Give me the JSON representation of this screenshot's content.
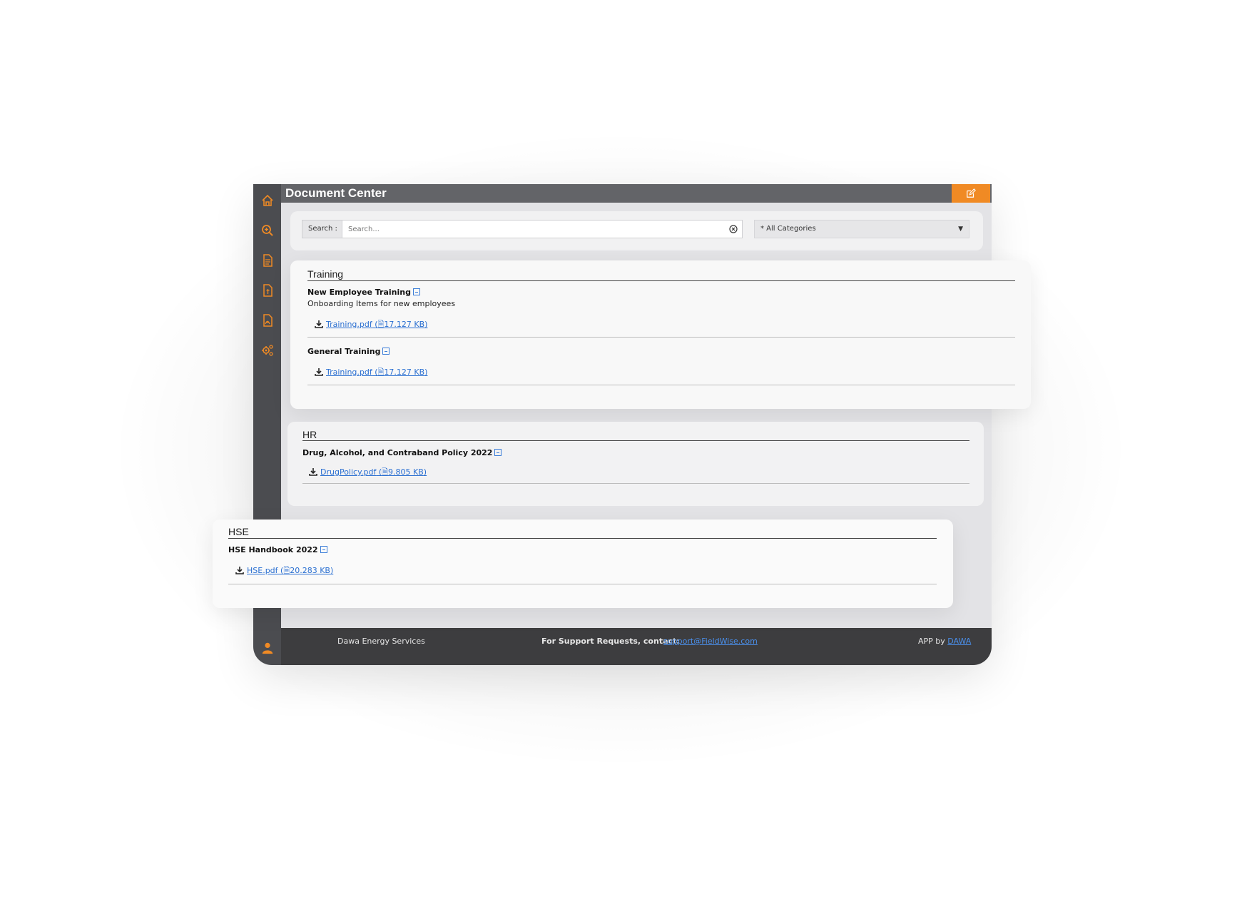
{
  "header": {
    "title": "Document Center"
  },
  "sidebar": {
    "icons": [
      "home-icon",
      "search-zoom-icon",
      "document-icon",
      "report-icon",
      "pdf-icon",
      "settings-icon"
    ],
    "user_icon": "user-icon"
  },
  "search": {
    "label": "Search :",
    "placeholder": "Search...",
    "category": "* All Categories"
  },
  "categories": [
    {
      "name": "Training",
      "items": [
        {
          "title": "New Employee Training",
          "description": "Onboarding Items for new employees",
          "file": {
            "name": "Training.pdf",
            "size": "17.127 KB"
          }
        },
        {
          "title": "General Training",
          "description": "",
          "file": {
            "name": "Training.pdf",
            "size": "17.127 KB"
          }
        }
      ]
    },
    {
      "name": "HR",
      "items": [
        {
          "title": "Drug, Alcohol, and Contraband Policy 2022",
          "description": "",
          "file": {
            "name": "DrugPolicy.pdf",
            "size": "9.805 KB"
          }
        }
      ]
    },
    {
      "name": "HSE",
      "items": [
        {
          "title": "HSE Handbook 2022",
          "description": "",
          "file": {
            "name": "HSE.pdf",
            "size": "20.283 KB"
          }
        }
      ]
    }
  ],
  "footer": {
    "company": "Dawa Energy Services",
    "support_label": "For Support Requests, contact:",
    "support_email": "support@FieldWise.com",
    "app_by": "APP by",
    "app_by_link": "DAWA"
  },
  "colors": {
    "accent": "#f08a24",
    "sidebar": "#4b4c50",
    "header": "#636468",
    "link": "#2a6fd1"
  }
}
